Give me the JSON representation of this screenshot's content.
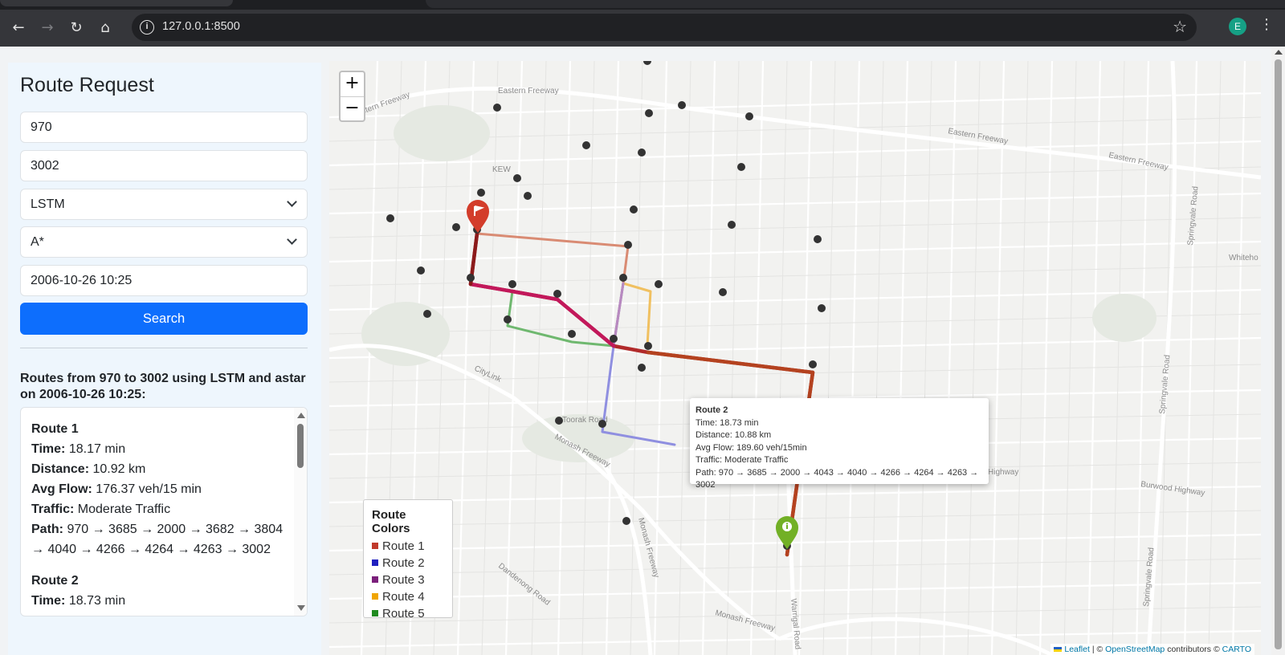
{
  "browser": {
    "url": "127.0.0.1:8500",
    "avatar_letter": "E"
  },
  "sidebar": {
    "title": "Route Request",
    "origin_value": "970",
    "destination_value": "3002",
    "model_value": "LSTM",
    "algorithm_value": "A*",
    "datetime_value": "2006-10-26 10:25",
    "search_label": "Search",
    "routes_heading": "Routes from 970 to 3002 using LSTM and astar on 2006-10-26 10:25:"
  },
  "results": [
    {
      "title": "Route 1",
      "time_label": "Time:",
      "time": "18.17 min",
      "distance_label": "Distance:",
      "distance": "10.92 km",
      "flow_label": "Avg Flow:",
      "flow": "176.37 veh/15 min",
      "traffic_label": "Traffic:",
      "traffic": "Moderate Traffic",
      "path_label": "Path:",
      "path_line1": "970 → 3685 → 2000 → 3682 → 3804",
      "path_line2": "→ 4040 → 4266 → 4264 → 4263 → 3002"
    },
    {
      "title": "Route 2",
      "time_label": "Time:",
      "time": "18.73 min"
    }
  ],
  "map": {
    "zoom_in": "+",
    "zoom_out": "−",
    "labels": {
      "kew": "KEW",
      "eastern_freeway_1": "Eastern Freeway",
      "eastern_freeway_2": "Eastern Freeway",
      "eastern_freeway_3": "Eastern Freeway",
      "eastern_freeway_4": "Eastern Freeway",
      "citylink": "CityLink",
      "toorak": "Toorak Road",
      "monash_1": "Monash Freeway",
      "monash_2": "Monash Freeway",
      "monash_3": "Monash Freeway",
      "dandenong": "Dandenong Road",
      "warrigal": "Warrigal Road",
      "springvale_1": "Springvale Road",
      "springvale_2": "Springvale Road",
      "springvale_3": "Springvale Road",
      "burwood": "Burwood Highway",
      "highway_partial": "Highway",
      "whitehorse_partial": "Whiteho"
    },
    "popup": {
      "title": "Route 2",
      "time": "Time: 18.73 min",
      "distance": "Distance: 10.88 km",
      "flow": "Avg Flow: 189.60 veh/15min",
      "traffic": "Traffic: Moderate Traffic",
      "path": "Path: 970 → 3685 → 2000 → 4043 → 4040 → 4266 → 4264 → 4263 → 3002"
    },
    "legend": {
      "title": "Route Colors",
      "items": [
        {
          "label": "Route 1",
          "color": "#c0392b"
        },
        {
          "label": "Route 2",
          "color": "#1f1fbf"
        },
        {
          "label": "Route 3",
          "color": "#7b1f7b"
        },
        {
          "label": "Route 4",
          "color": "#f0a500"
        },
        {
          "label": "Route 5",
          "color": "#1f8a1f"
        }
      ]
    },
    "attribution": {
      "leaflet": "Leaflet",
      "sep1": "| ©",
      "osm": "OpenStreetMap",
      "contrib": "contributors ©",
      "carto": "CARTO"
    }
  }
}
